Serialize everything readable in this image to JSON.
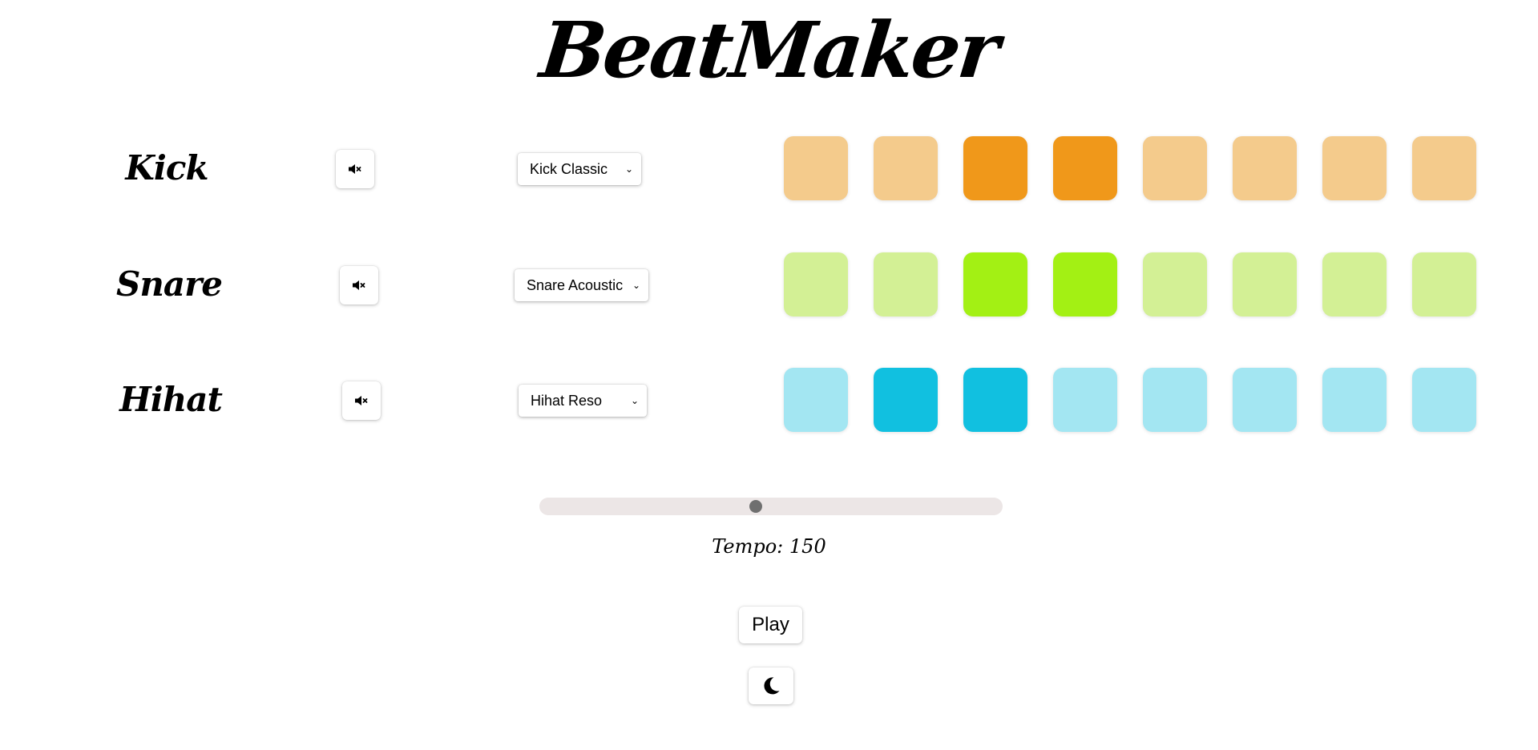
{
  "app": {
    "title": "BeatMaker"
  },
  "tracks": [
    {
      "name": "Kick",
      "sound": "Kick Classic",
      "muted": false,
      "color_active": "#f0981a",
      "color_inactive": "#f4cb8c",
      "steps": [
        false,
        false,
        true,
        true,
        false,
        false,
        false,
        false
      ]
    },
    {
      "name": "Snare",
      "sound": "Snare Acoustic",
      "muted": false,
      "color_active": "#a3f014",
      "color_inactive": "#d3f095",
      "steps": [
        false,
        false,
        true,
        true,
        false,
        false,
        false,
        false
      ]
    },
    {
      "name": "Hihat",
      "sound": "Hihat Reso",
      "muted": false,
      "color_active": "#11c0e0",
      "color_inactive": "#a3e6f2",
      "steps": [
        false,
        true,
        true,
        false,
        false,
        false,
        false,
        false
      ]
    }
  ],
  "tempo": {
    "label": "Tempo: 150",
    "value": 150,
    "min": 20,
    "max": 300
  },
  "controls": {
    "play_label": "Play",
    "mute_icon": "speaker-muted-icon",
    "theme_icon": "moon-icon"
  }
}
